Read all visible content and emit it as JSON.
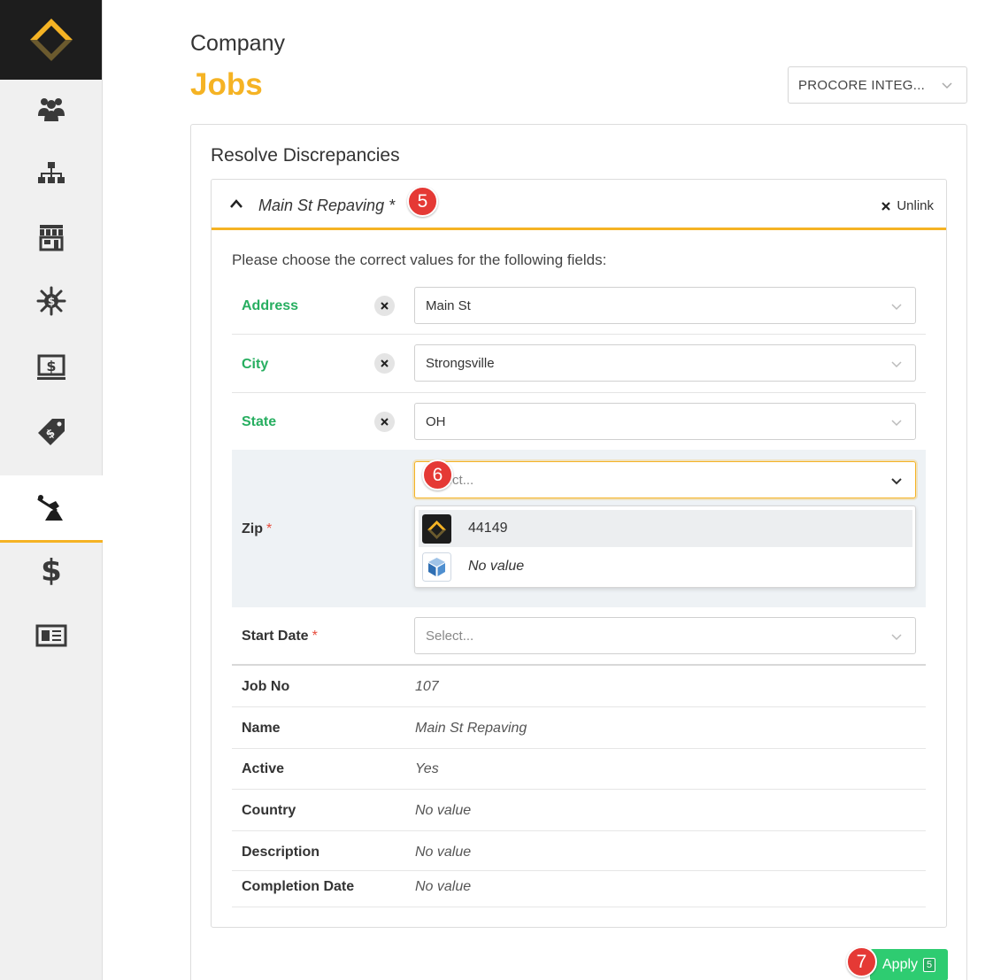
{
  "header": {
    "breadcrumb": "Company",
    "title": "Jobs",
    "integration_select": "PROCORE INTEG..."
  },
  "panel": {
    "title": "Resolve Discrepancies",
    "job_title": "Main St Repaving *",
    "unlink_label": "Unlink",
    "instruction": "Please choose the correct values for the following fields:"
  },
  "fields": {
    "address": {
      "label": "Address",
      "value": "Main St"
    },
    "city": {
      "label": "City",
      "value": "Strongsville"
    },
    "state": {
      "label": "State",
      "value": "OH"
    },
    "zip": {
      "label": "Zip",
      "required": "*",
      "placeholder": "Select..."
    },
    "start_date": {
      "label": "Start Date",
      "required": "*",
      "placeholder": "Select..."
    }
  },
  "zip_options": [
    {
      "label": "44149",
      "source_icon": "procore-logo-icon"
    },
    {
      "label": "No value",
      "source_icon": "cube-app-icon"
    }
  ],
  "details": [
    {
      "label": "Job No",
      "value": "107"
    },
    {
      "label": "Name",
      "value": "Main St Repaving"
    },
    {
      "label": "Active",
      "value": "Yes"
    },
    {
      "label": "Country",
      "value": "No value"
    },
    {
      "label": "Description",
      "value": "No value"
    },
    {
      "label": "Completion Date",
      "value": "No value"
    }
  ],
  "annotations": {
    "step5": "5",
    "step6": "6",
    "step7": "7"
  },
  "apply": {
    "label": "Apply",
    "count": "5"
  },
  "colors": {
    "accent": "#f5b324",
    "green": "#27ae60",
    "apply": "#2ecc71",
    "badge": "#e53935"
  }
}
